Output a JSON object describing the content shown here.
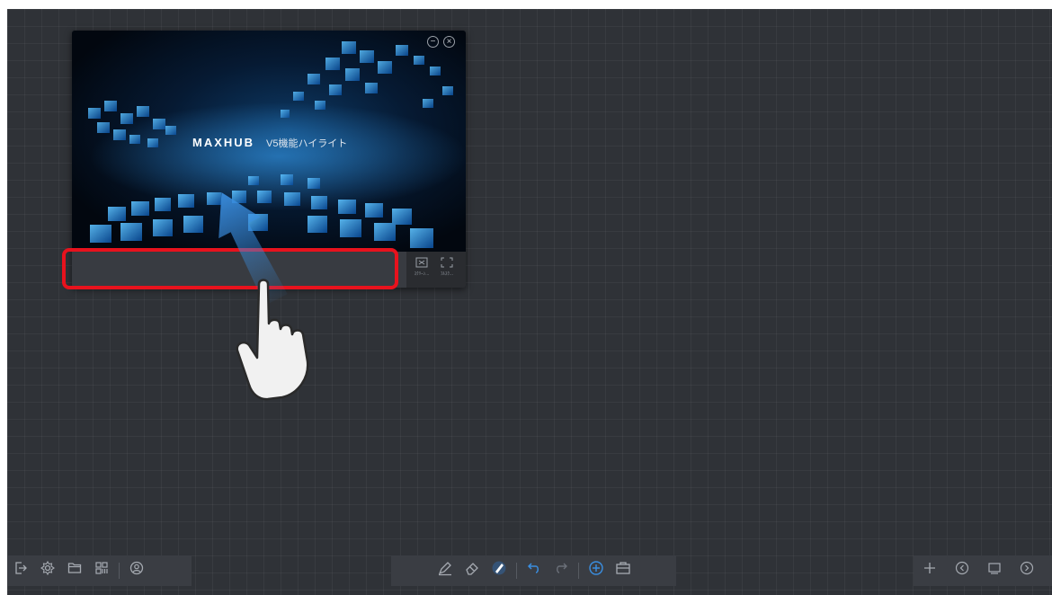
{
  "video": {
    "brand": "MAXHUB",
    "title": "V5機能ハイライト",
    "minimize_icon": "minus-circle-icon",
    "close_icon": "close-circle-icon",
    "controls": [
      {
        "label": "ｽｸﾘｰﾝ...",
        "icon": "screen-capture-icon"
      },
      {
        "label": "ﾌﾙｽｸ...",
        "icon": "fullscreen-icon"
      }
    ]
  },
  "annotation": {
    "highlight_color": "#e8121d",
    "gesture": "swipe-up-hand-icon"
  },
  "toolbar": {
    "left": [
      "exit-icon",
      "settings-icon",
      "folder-icon",
      "qr-code-icon",
      "account-icon"
    ],
    "center": [
      "pen-icon",
      "eraser-icon",
      "brush-icon",
      "undo-icon",
      "redo-icon",
      "add-icon",
      "toolbox-icon"
    ],
    "right": [
      "plus-icon",
      "page-prev-icon",
      "page-overview-icon",
      "page-next-icon"
    ]
  },
  "colors": {
    "board": "#2f3237",
    "toolbar": "#3a3d43",
    "accent_blue": "#3a8ee0"
  }
}
